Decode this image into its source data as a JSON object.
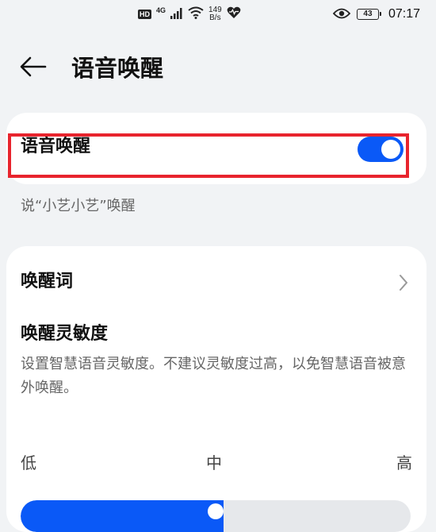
{
  "status_bar": {
    "hd_label": "HD",
    "network_label": "4G",
    "speed_value": "149",
    "speed_unit": "B/s",
    "battery_level": "43",
    "time": "07:17"
  },
  "header": {
    "title": "语音唤醒"
  },
  "voice_wake": {
    "label": "语音唤醒",
    "enabled": true,
    "description": "说“小艺小艺”唤醒"
  },
  "wake_word": {
    "label": "唤醒词"
  },
  "sensitivity": {
    "title": "唤醒灵敏度",
    "description": "设置智慧语音灵敏度。不建议灵敏度过高，以免智慧语音被意外唤醒。",
    "levels": [
      "低",
      "中",
      "高"
    ],
    "value_fraction": 0.5
  },
  "colors": {
    "accent": "#0a59f7",
    "highlight": "#e8242d",
    "background": "#f1f3f5"
  }
}
